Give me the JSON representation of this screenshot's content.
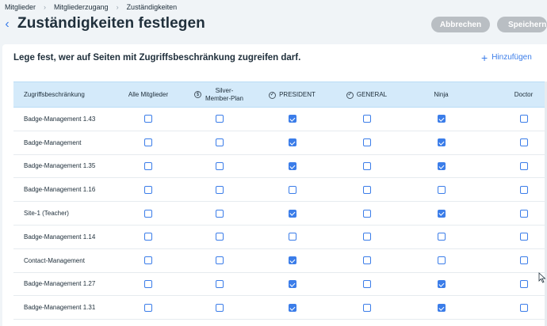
{
  "breadcrumb": [
    "Mitglieder",
    "Mitgliederzugang",
    "Zuständigkeiten"
  ],
  "page_title": "Zuständigkeiten festlegen",
  "buttons": {
    "cancel": "Abbrechen",
    "save": "Speichern"
  },
  "card": {
    "title": "Lege fest, wer auf Seiten mit Zugriffsbeschränkung zugreifen darf.",
    "add_label": "Hinzufügen"
  },
  "table": {
    "columns": [
      {
        "label": "Zugriffsbeschränkung",
        "icon": ""
      },
      {
        "label": "Alle Mitglieder",
        "icon": ""
      },
      {
        "label": "Silver-Member-Plan",
        "icon": "dollar-circle-icon"
      },
      {
        "label": "PRESIDENT",
        "icon": "check-circle-icon"
      },
      {
        "label": "GENERAL",
        "icon": "check-circle-icon"
      },
      {
        "label": "Ninja",
        "icon": ""
      },
      {
        "label": "Doctor",
        "icon": ""
      }
    ],
    "rows": [
      {
        "name": "Badge-Management 1.43",
        "checks": [
          false,
          false,
          true,
          false,
          true,
          false
        ]
      },
      {
        "name": "Badge-Management",
        "checks": [
          false,
          false,
          true,
          false,
          true,
          false
        ]
      },
      {
        "name": "Badge-Management 1.35",
        "checks": [
          false,
          false,
          true,
          false,
          true,
          false
        ]
      },
      {
        "name": "Badge-Management 1.16",
        "checks": [
          false,
          false,
          false,
          false,
          false,
          false
        ]
      },
      {
        "name": "Site-1 (Teacher)",
        "checks": [
          false,
          false,
          true,
          false,
          true,
          false
        ]
      },
      {
        "name": "Badge-Management 1.14",
        "checks": [
          false,
          false,
          false,
          false,
          false,
          false
        ]
      },
      {
        "name": "Contact-Management",
        "checks": [
          false,
          false,
          true,
          false,
          false,
          false
        ]
      },
      {
        "name": "Badge-Management 1.27",
        "checks": [
          false,
          false,
          true,
          false,
          true,
          false
        ]
      },
      {
        "name": "Badge-Management 1.31",
        "checks": [
          false,
          false,
          true,
          false,
          true,
          false
        ]
      }
    ]
  },
  "colors": {
    "accent": "#3b7de9",
    "header_bg": "#d4eafa",
    "button_disabled": "#b9bec3",
    "page_bg": "#f0f4f7"
  }
}
